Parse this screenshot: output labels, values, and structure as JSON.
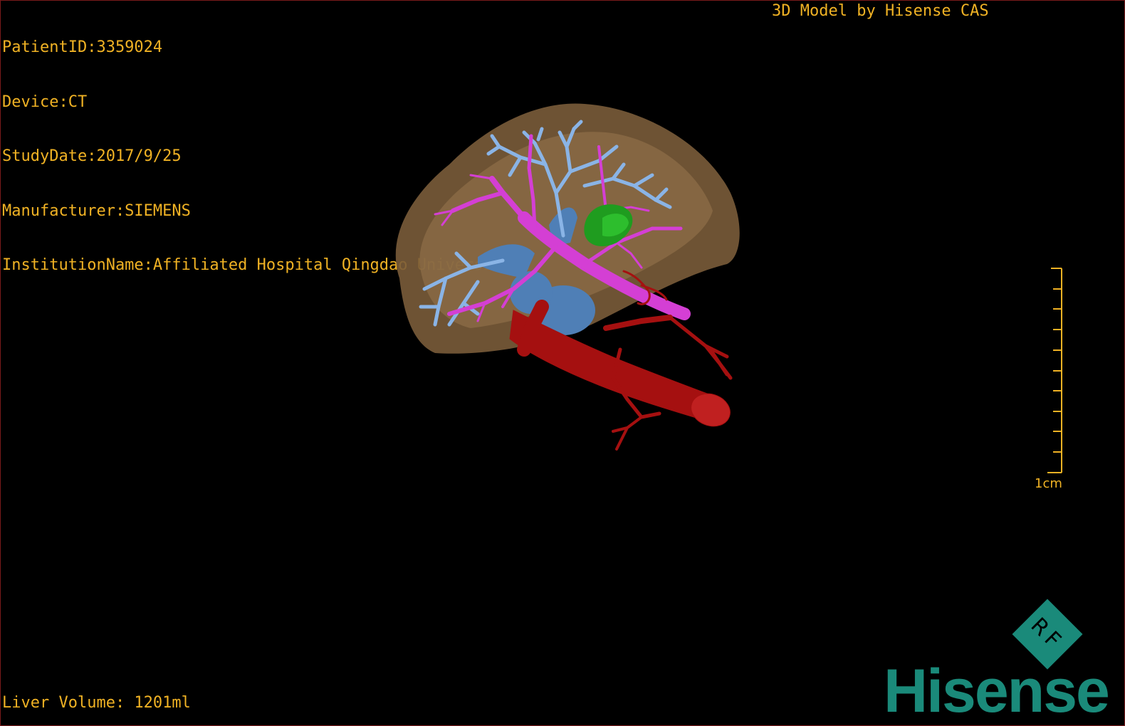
{
  "study_info": {
    "patient_id": "PatientID:3359024",
    "device": "Device:CT",
    "study_date": "StudyDate:2017/9/25",
    "manufacturer": "Manufacturer:SIEMENS",
    "institution": "InstitutionName:Affiliated Hospital Qingdao University-C"
  },
  "header_right": "3D Model by Hisense CAS",
  "liver_volume": "Liver Volume: 1201ml",
  "scale": {
    "label": "1cm"
  },
  "brand": {
    "name": "Hisense",
    "badge_letters": "RF",
    "color": "#1a8a7a"
  },
  "colors": {
    "overlay_text": "#f0b224",
    "liver": "#8a6a45",
    "portal_vein": "#d63fd6",
    "hepatic_vein": "#7aa6d8",
    "ivc": "#4a78b0",
    "artery": "#b01010",
    "gallbladder": "#22a022"
  }
}
